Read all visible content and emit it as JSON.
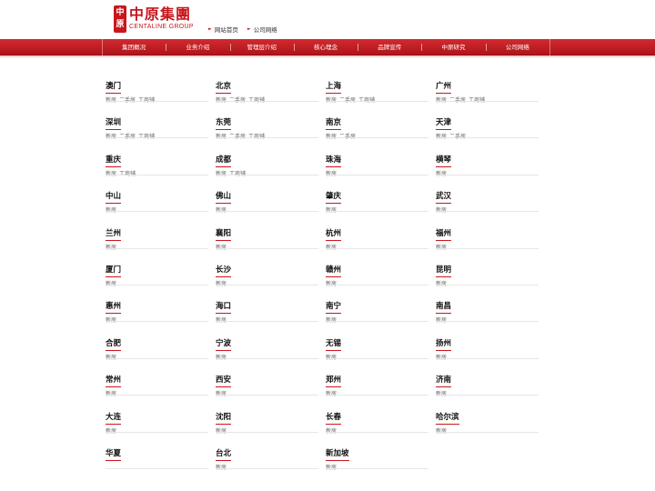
{
  "header": {
    "logo_seal": "中原",
    "logo_cn": "中原集團",
    "logo_en": "CENTALINE GROUP",
    "links": [
      "网站首页",
      "公司网络"
    ]
  },
  "nav": [
    "集团概况",
    "业务介绍",
    "管理层介绍",
    "核心理念",
    "品牌宣传",
    "中原研究",
    "公司网络"
  ],
  "cities": [
    {
      "name": "澳门",
      "links": [
        "新房",
        "二手房",
        "工商铺"
      ]
    },
    {
      "name": "北京",
      "links": [
        "新房",
        "二手房",
        "工商铺"
      ]
    },
    {
      "name": "上海",
      "links": [
        "新房",
        "二手房",
        "工商铺"
      ]
    },
    {
      "name": "广州",
      "links": [
        "新房",
        "二手房",
        "工商铺"
      ]
    },
    {
      "name": "深圳",
      "links": [
        "新房",
        "二手房",
        "工商铺"
      ]
    },
    {
      "name": "东莞",
      "links": [
        "新房",
        "二手房",
        "工商铺"
      ]
    },
    {
      "name": "南京",
      "links": [
        "新房",
        "二手房"
      ]
    },
    {
      "name": "天津",
      "links": [
        "新房",
        "二手房"
      ]
    },
    {
      "name": "重庆",
      "links": [
        "新房",
        "工商铺"
      ]
    },
    {
      "name": "成都",
      "links": [
        "新房",
        "工商铺"
      ]
    },
    {
      "name": "珠海",
      "links": [
        "新房"
      ]
    },
    {
      "name": "横琴",
      "links": [
        "新房"
      ]
    },
    {
      "name": "中山",
      "links": [
        "新房"
      ]
    },
    {
      "name": "佛山",
      "links": [
        "新房"
      ]
    },
    {
      "name": "肇庆",
      "links": [
        "新房"
      ]
    },
    {
      "name": "武汉",
      "links": [
        "新房"
      ]
    },
    {
      "name": "兰州",
      "links": [
        "新房"
      ]
    },
    {
      "name": "襄阳",
      "links": [
        "新房"
      ]
    },
    {
      "name": "杭州",
      "links": [
        "新房"
      ]
    },
    {
      "name": "福州",
      "links": [
        "新房"
      ]
    },
    {
      "name": "厦门",
      "links": [
        "新房"
      ]
    },
    {
      "name": "长沙",
      "links": [
        "新房"
      ]
    },
    {
      "name": "赣州",
      "links": [
        "新房"
      ]
    },
    {
      "name": "昆明",
      "links": [
        "新房"
      ]
    },
    {
      "name": "惠州",
      "links": [
        "新房"
      ]
    },
    {
      "name": "海口",
      "links": [
        "新房"
      ]
    },
    {
      "name": "南宁",
      "links": [
        "新房"
      ]
    },
    {
      "name": "南昌",
      "links": [
        "新房"
      ]
    },
    {
      "name": "合肥",
      "links": [
        "新房"
      ]
    },
    {
      "name": "宁波",
      "links": [
        "新房"
      ]
    },
    {
      "name": "无锡",
      "links": [
        "新房"
      ]
    },
    {
      "name": "扬州",
      "links": [
        "新房"
      ]
    },
    {
      "name": "常州",
      "links": [
        "新房"
      ]
    },
    {
      "name": "西安",
      "links": [
        "新房"
      ]
    },
    {
      "name": "郑州",
      "links": [
        "新房"
      ]
    },
    {
      "name": "济南",
      "links": [
        "新房"
      ]
    },
    {
      "name": "大连",
      "links": [
        "新房"
      ]
    },
    {
      "name": "沈阳",
      "links": [
        "新房"
      ]
    },
    {
      "name": "长春",
      "links": [
        "新房"
      ]
    },
    {
      "name": "哈尔滨",
      "links": [
        "新房"
      ]
    },
    {
      "name": "华夏",
      "links": []
    },
    {
      "name": "台北",
      "links": [
        "新房"
      ]
    },
    {
      "name": "新加坡",
      "links": [
        "新房"
      ]
    }
  ],
  "colors": {
    "brand": "#c8161d",
    "nav_bg": "#c41e24"
  }
}
